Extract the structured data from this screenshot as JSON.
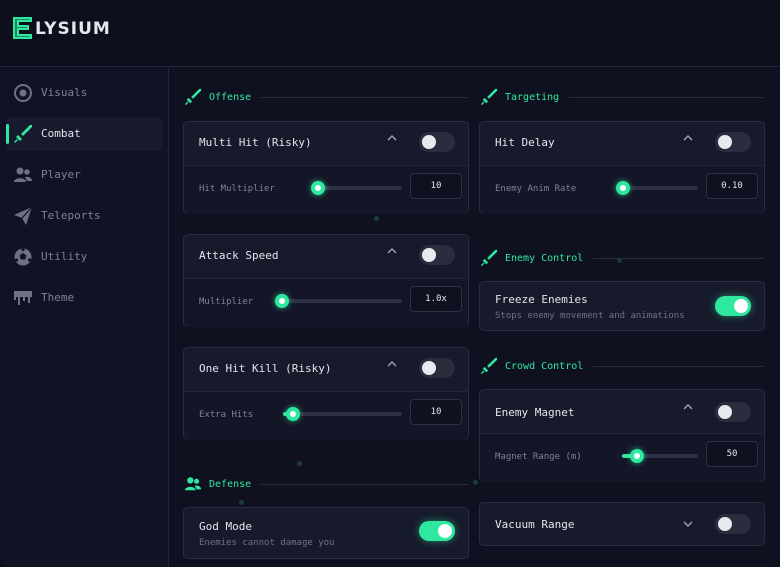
{
  "app": {
    "brand": "LYSIUM"
  },
  "sidebar": {
    "items": [
      {
        "label": "Visuals",
        "icon": "eye-icon"
      },
      {
        "label": "Combat",
        "icon": "sword-icon"
      },
      {
        "label": "Player",
        "icon": "users-icon"
      },
      {
        "label": "Teleports",
        "icon": "paper-plane-icon"
      },
      {
        "label": "Utility",
        "icon": "soccer-ball-icon"
      },
      {
        "label": "Theme",
        "icon": "paint-drip-icon"
      }
    ],
    "active_index": 1
  },
  "sections": {
    "offense": "Offense",
    "targeting": "Targeting",
    "enemy_control": "Enemy Control",
    "crowd_control": "Crowd Control",
    "defense": "Defense"
  },
  "cards": {
    "multi_hit": {
      "title": "Multi Hit (Risky)",
      "toggle": false,
      "row_label": "Hit Multiplier",
      "value": "10",
      "fraction": 0.0
    },
    "attack_speed": {
      "title": "Attack Speed",
      "toggle": false,
      "row_label": "Multiplier",
      "value": "1.0x",
      "fraction": 0.0
    },
    "one_hit_kill": {
      "title": "One Hit Kill (Risky)",
      "toggle": false,
      "row_label": "Extra Hits",
      "value": "10",
      "fraction": 0.08
    },
    "god_mode": {
      "title": "God Mode",
      "subtitle": "Enemies cannot damage you",
      "toggle": true
    },
    "hit_delay": {
      "title": "Hit Delay",
      "toggle": false,
      "row_label": "Enemy Anim Rate",
      "value": "0.10",
      "fraction": 0.0
    },
    "freeze_enemies": {
      "title": "Freeze Enemies",
      "subtitle": "Stops enemy movement and animations",
      "toggle": true
    },
    "enemy_magnet": {
      "title": "Enemy Magnet",
      "toggle": false,
      "row_label": "Magnet Range (m)",
      "value": "50",
      "fraction": 0.2
    },
    "vacuum_range": {
      "title": "Vacuum Range",
      "toggle": false
    }
  },
  "colors": {
    "accent": "#2ee8a0",
    "background": "#0f1120",
    "card": "#171a2b"
  }
}
